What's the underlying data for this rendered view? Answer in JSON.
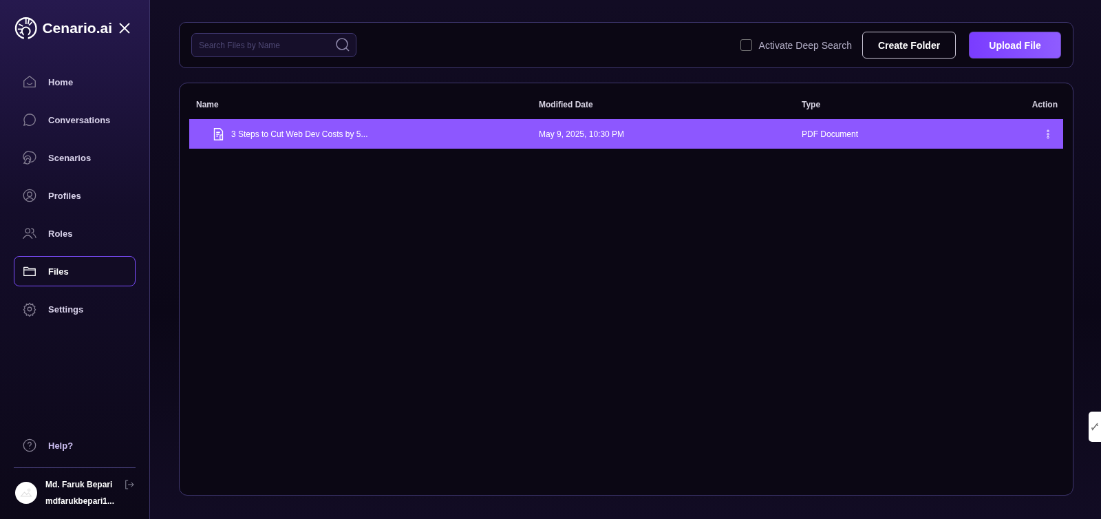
{
  "sidebar": {
    "brand": "Cenario.ai",
    "items": [
      {
        "label": "Home",
        "selected": false
      },
      {
        "label": "Conversations",
        "selected": false
      },
      {
        "label": "Scenarios",
        "selected": false
      },
      {
        "label": "Profiles",
        "selected": false
      },
      {
        "label": "Roles",
        "selected": false
      },
      {
        "label": "Files",
        "selected": true
      },
      {
        "label": "Settings",
        "selected": false
      }
    ],
    "help": "Help?",
    "user": {
      "name": "Md. Faruk Bepari",
      "email": "mdfarukbepari1..."
    }
  },
  "toolbar": {
    "search": {
      "placeholder": "Search Files by Name"
    },
    "deep_search": {
      "label": "Activate Deep Search",
      "checked": false
    },
    "buttons": [
      {
        "label": "Create Folder",
        "kind": "outline"
      },
      {
        "label": "Upload File",
        "kind": "primary"
      }
    ]
  },
  "table": {
    "columns": [
      "Name",
      "Modified Date",
      "Type",
      "Action"
    ],
    "rows": [
      {
        "name": "3 Steps to Cut Web Dev Costs by 5...",
        "modified": "May 9, 2025, 10:30 PM",
        "type": "PDF Document",
        "selected": true
      }
    ]
  }
}
